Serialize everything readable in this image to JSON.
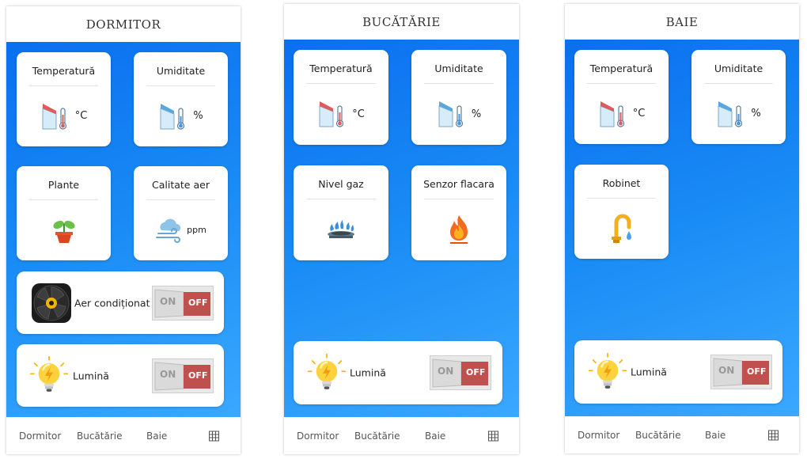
{
  "dormitor": {
    "title": "DORMITOR",
    "cards": {
      "temperature": {
        "label": "Temperatură",
        "unit": "°C"
      },
      "humidity": {
        "label": "Umiditate",
        "unit": "%"
      },
      "plants": {
        "label": "Plante"
      },
      "air_quality": {
        "label": "Calitate aer",
        "unit": "ppm"
      }
    },
    "ac": {
      "label": "Aer condiționat",
      "on": "ON",
      "off": "OFF"
    },
    "light": {
      "label": "Lumină",
      "on": "ON",
      "off": "OFF"
    }
  },
  "bucatarie": {
    "title": "BUCĂTĂRIE",
    "cards": {
      "temperature": {
        "label": "Temperatură",
        "unit": "°C"
      },
      "humidity": {
        "label": "Umiditate",
        "unit": "%"
      },
      "gas": {
        "label": "Nivel gaz"
      },
      "flame": {
        "label": "Senzor flacara"
      }
    },
    "light": {
      "label": "Lumină",
      "on": "ON",
      "off": "OFF"
    }
  },
  "baie": {
    "title": "BAIE",
    "cards": {
      "temperature": {
        "label": "Temperatură",
        "unit": "°C"
      },
      "humidity": {
        "label": "Umiditate",
        "unit": "%"
      },
      "faucet": {
        "label": "Robinet"
      }
    },
    "light": {
      "label": "Lumină",
      "on": "ON",
      "off": "OFF"
    }
  },
  "nav": {
    "dormitor": "Dormitor",
    "bucatarie": "Bucătărie",
    "baie": "Baie",
    "grid_icon": "grid-icon"
  },
  "colors": {
    "gradient_start": "#0a6ff0",
    "gradient_end": "#3aa8ff",
    "switch_off": "#c0504d"
  }
}
